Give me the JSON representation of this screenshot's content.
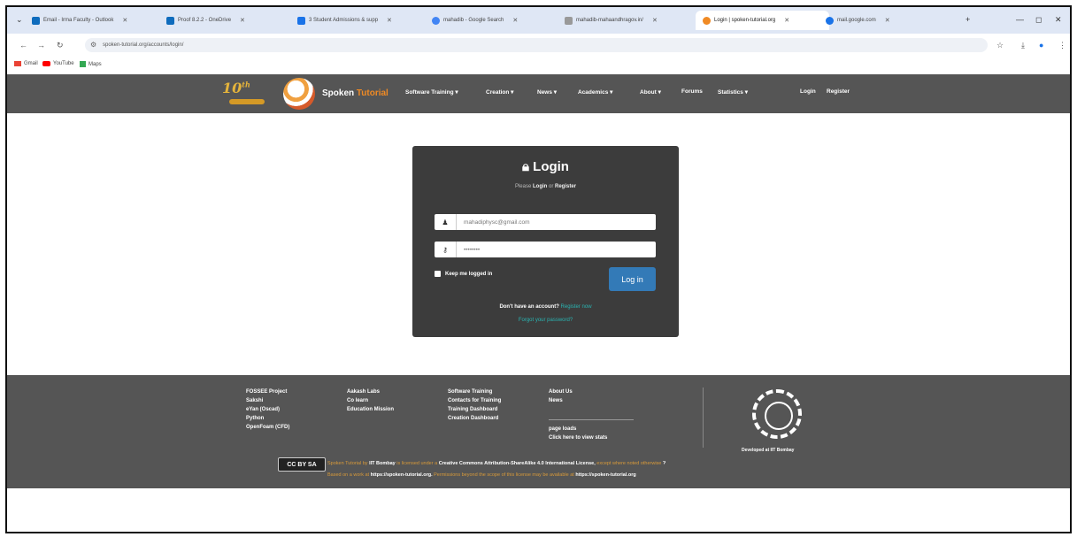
{
  "browser": {
    "tabs": [
      {
        "label": "Email - Irma Faculty - Outlook",
        "color": "#0f6cbd"
      },
      {
        "label": "Proof 8.2.2 - OneDrive",
        "color": "#0f6cbd"
      },
      {
        "label": "3 Student Admissions & supp",
        "color": "#1a73e8"
      },
      {
        "label": "mahadib - Google Search",
        "color": "#4285f4"
      },
      {
        "label": "mahadib-mahaandhragov.in/",
        "color": "#999999"
      },
      {
        "label": "Login | spoken-tutorial.org",
        "color": "#f08a24"
      },
      {
        "label": "mail.google.com",
        "color": "#1a73e8"
      }
    ],
    "url": "spoken-tutorial.org/accounts/login/",
    "bookmarks": [
      {
        "label": "Gmail",
        "color": "#ea4335"
      },
      {
        "label": "YouTube",
        "color": "#ff0000"
      },
      {
        "label": "Maps",
        "color": "#34a853"
      }
    ]
  },
  "site": {
    "logo_badge": "10",
    "brand_part1": "Spoken",
    "brand_part2": "Tutorial",
    "menu": [
      "Software Training ▾",
      "Creation ▾",
      "News ▾",
      "Academics ▾",
      "About ▾",
      "Forums",
      "Statistics ▾",
      "Login",
      "Register"
    ]
  },
  "login": {
    "title": "Login",
    "subtitle_prefix": "Please",
    "subtitle_login": "Login",
    "subtitle_or": "or",
    "subtitle_register": "Register",
    "username_value": "mahadiphysc@gmail.com",
    "password_value": "••••••••",
    "remember_label": "Keep me logged in",
    "button_label": "Log in",
    "no_account": "Don't have an account?",
    "register_link": "Register now",
    "forgot_link": "Forgot your password?"
  },
  "footer": {
    "col1": [
      "FOSSEE Project",
      "Sakshi",
      "eYan (Oscad)",
      "Python",
      "OpenFoam (CFD)"
    ],
    "col2": [
      "Aakash Labs",
      "Co learn",
      "Education Mission"
    ],
    "col3": [
      "Software Training",
      "Contacts for Training",
      "Training Dashboard",
      "Creation Dashboard"
    ],
    "col4_top": [
      "About Us",
      "News"
    ],
    "col4_bottom": [
      "page loads",
      "Click here to view stats"
    ],
    "developed_by": "Developed at IIT Bombay",
    "cc_badge": "CC BY SA",
    "license_line1_a": "Spoken Tutorial by",
    "license_line1_b": "IIT Bombay",
    "license_line1_c": "is licensed under a",
    "license_line1_d": "Creative Commons Attribution-ShareAlike 4.0 International License,",
    "license_line1_e": "except where noted otherwise",
    "license_line2_a": "Based on a work at",
    "license_line2_b": "https://spoken-tutorial.org.",
    "license_line2_c": "Permissions beyond the scope of this license may be available at",
    "license_line2_d": "https://spoken-tutorial.org"
  }
}
